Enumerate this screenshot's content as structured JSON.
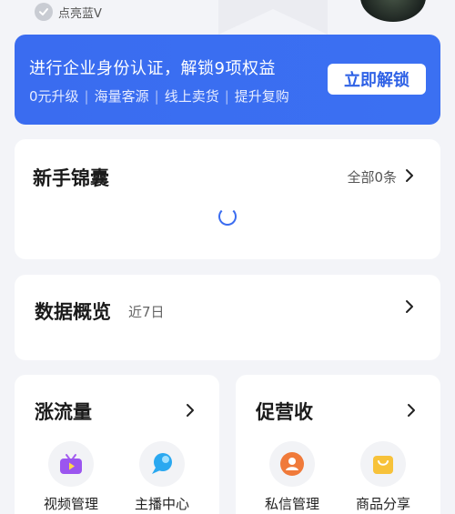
{
  "header": {
    "verify_badge": "点亮蓝V"
  },
  "banner": {
    "title": "进行企业身份认证，解锁9项权益",
    "benefits": [
      "0元升级",
      "海量客源",
      "线上卖货",
      "提升复购"
    ],
    "separator": "|",
    "button_label": "立即解锁"
  },
  "guide_card": {
    "title": "新手锦囊",
    "more_label": "全部0条"
  },
  "data_card": {
    "title": "数据概览",
    "range_label": "近7日"
  },
  "traffic_card": {
    "title": "涨流量",
    "tools": [
      {
        "label": "视频管理",
        "icon": "tv-icon"
      },
      {
        "label": "主播中心",
        "icon": "chat-bubble-icon"
      }
    ]
  },
  "revenue_card": {
    "title": "促营收",
    "tools": [
      {
        "label": "私信管理",
        "icon": "user-message-icon"
      },
      {
        "label": "商品分享",
        "icon": "shopping-bag-icon"
      }
    ]
  },
  "colors": {
    "banner_blue": "#3a6cf0",
    "button_text": "#2f62e6",
    "page_bg": "#f3f4f8"
  }
}
